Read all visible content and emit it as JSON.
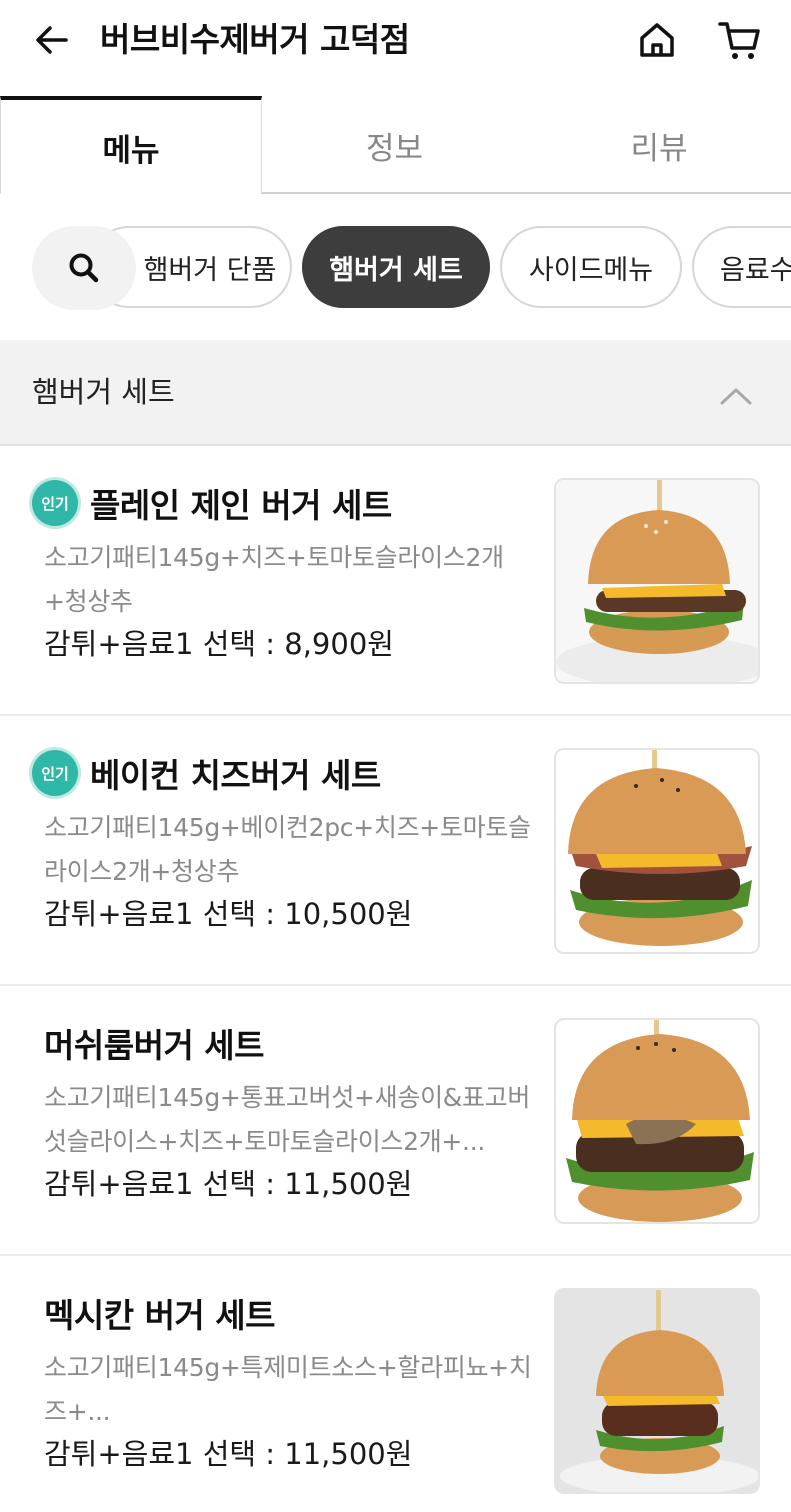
{
  "header": {
    "title": "버브비수제버거 고덕점"
  },
  "tabs": [
    {
      "label": "메뉴",
      "active": true
    },
    {
      "label": "정보",
      "active": false
    },
    {
      "label": "리뷰",
      "active": false
    }
  ],
  "filters": {
    "chips": [
      {
        "label": "햄버거 단품",
        "selected": false
      },
      {
        "label": "햄버거 세트",
        "selected": true
      },
      {
        "label": "사이드메뉴",
        "selected": false
      },
      {
        "label": "음료수",
        "selected": false
      }
    ]
  },
  "section": {
    "title": "햄버거 세트"
  },
  "items": [
    {
      "badge": "인기",
      "name": "플레인 제인 버거 세트",
      "desc": "소고기패티145g+치즈+토마토슬라이스2개+청상추",
      "price": "감튀+음료1 선택 : 8,900원"
    },
    {
      "badge": "인기",
      "name": "베이컨 치즈버거 세트",
      "desc": "소고기패티145g+베이컨2pc+치즈+토마토슬라이스2개+청상추",
      "price": "감튀+음료1 선택 : 10,500원"
    },
    {
      "badge": "",
      "name": "머쉬룸버거 세트",
      "desc": "소고기패티145g+통표고버섯+새송이&표고버섯슬라이스+치즈+토마토슬라이스2개+...",
      "price": "감튀+음료1 선택 : 11,500원"
    },
    {
      "badge": "",
      "name": "멕시칸 버거 세트",
      "desc": "소고기패티145g+특제미트소스+할라피뇨+치즈+...",
      "price": "감튀+음료1 선택 : 11,500원"
    }
  ],
  "colors": {
    "badge": "#2fb8a8",
    "chip_selected": "#3d3d3d",
    "section_bg": "#f2f2f2"
  },
  "icons": [
    "arrow-left-icon",
    "home-icon",
    "cart-icon",
    "search-icon",
    "chevron-up-icon",
    "burger-photo"
  ]
}
